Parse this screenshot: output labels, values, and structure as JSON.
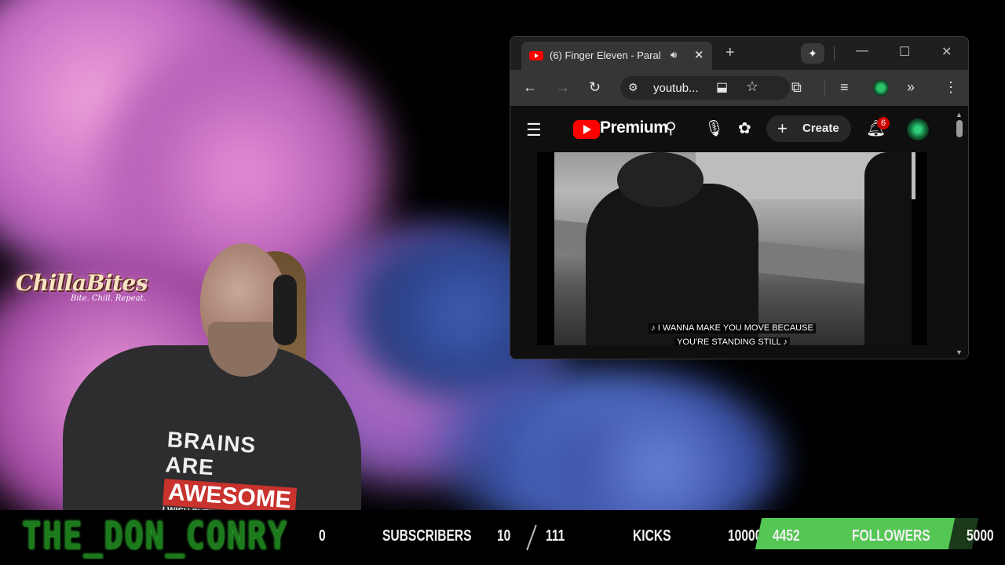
{
  "background": {
    "logo_text": "ChillaBites",
    "logo_tagline": "Bite. Chill. Repeat."
  },
  "streamer": {
    "shirt_line1": "BRAINS ARE",
    "shirt_line2": "AWESOME",
    "shirt_line3": "I WISH EVERYO"
  },
  "browser": {
    "tab_title": "(6) Finger Eleven - Paral",
    "url": "youtub...",
    "icons": [
      "youtube-icon",
      "speaker-icon",
      "close-icon",
      "plus-icon",
      "gemini-icon",
      "minimize-icon",
      "maximize-icon",
      "back-icon",
      "forward-icon",
      "reload-icon",
      "site-info-icon",
      "install-icon",
      "star-icon",
      "extensions-icon",
      "media-icon",
      "profile-icon",
      "overflow-icon",
      "menu-icon"
    ]
  },
  "youtube": {
    "logo_text": "Premium",
    "create_label": "Create",
    "notification_count": "6",
    "subtitle_line1": "♪ I WANNA MAKE YOU MOVE BECAUSE",
    "subtitle_line2": "YOU'RE STANDING STILL ♪"
  },
  "stats": {
    "channel_name": "THE_DON_CONRY",
    "subscribers_count": "0",
    "subscribers_label": "SUBSCRIBERS",
    "kicks_current": "10",
    "kicks_goal": "111",
    "kicks_label": "KICKS",
    "followers_start": "10000",
    "followers_current": "4452",
    "followers_label": "FOLLOWERS",
    "followers_goal": "5000",
    "followers_progress": 0.89,
    "accent_color": "#53c653"
  }
}
